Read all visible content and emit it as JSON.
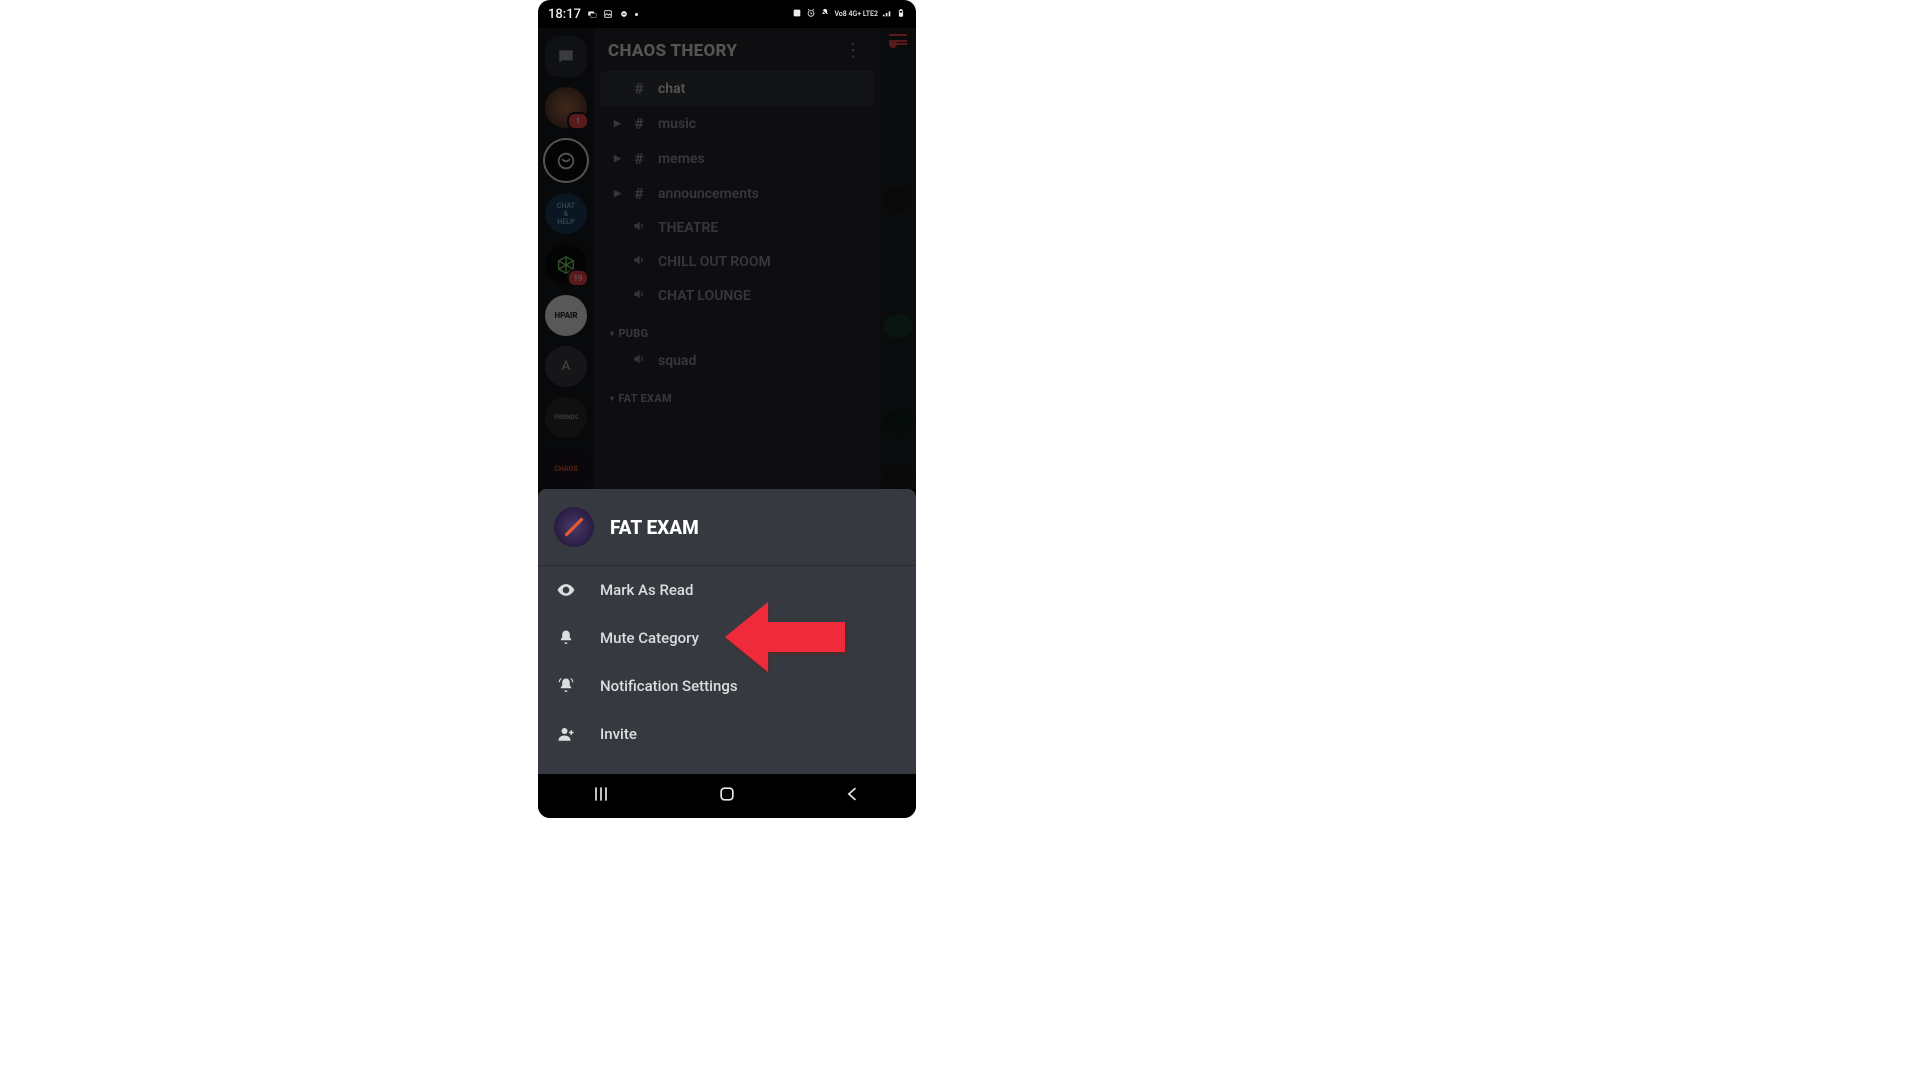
{
  "status": {
    "time": "18:17",
    "network": "Vo8 4G+ LTE2"
  },
  "server": {
    "title": "CHAOS THEORY",
    "channels": {
      "chat": "chat",
      "music": "music",
      "memes": "memes",
      "announcements": "announcements",
      "theatre": "THEATRE",
      "chill": "CHILL OUT ROOM",
      "lounge": "CHAT LOUNGE",
      "squad": "squad"
    },
    "categories": {
      "pubg": "PUBG",
      "fat_exam": "FAT EXAM"
    }
  },
  "servers": {
    "avatar2_badge": "1",
    "cube_badge": "19",
    "hpair": "HPAIR",
    "a": "A",
    "friends": "FRIENDS",
    "chaos": "CHAOS"
  },
  "sheet": {
    "title": "FAT EXAM",
    "items": {
      "mark_read": "Mark As Read",
      "mute": "Mute Category",
      "notif": "Notification Settings",
      "invite": "Invite"
    }
  }
}
